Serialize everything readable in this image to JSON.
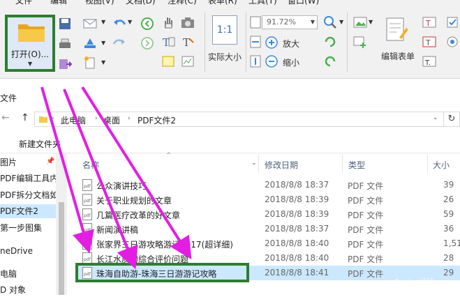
{
  "menubar": {
    "items": [
      "文件",
      "编辑",
      "视图(V)",
      "文档(D)",
      "注释(C)",
      "表单(R)",
      "工具(T)",
      "窗口(W)"
    ]
  },
  "ribbon": {
    "open_label": "打开(O)...",
    "zoom_value": "91.72%",
    "zoom_in_label": "放大",
    "zoom_out_label": "缩小",
    "actual_size_label": "实际大小",
    "actual_size_icon_text": "1:1",
    "edit_form_label": "编辑表单",
    "colors": {
      "highlight_border": "#2e7d32",
      "arrow": "#e31ee3"
    }
  },
  "explorer": {
    "title": "文件",
    "breadcrumb": [
      "此电脑",
      "桌面",
      "PDF文件2"
    ],
    "new_folder_label": "新建文件夹",
    "nav_items": [
      "图片",
      "PDF编辑工具内公",
      "PDF拆分文档如何",
      "PDF文件2",
      "第一步图集",
      "neDrive",
      "电脑",
      "D 对象"
    ],
    "selected_nav": "PDF文件2",
    "columns": {
      "name": "名称",
      "date": "修改日期",
      "type": "类型",
      "size": "大小"
    },
    "files": [
      {
        "name": "公众演讲技巧",
        "date": "2018/8/8 18:37",
        "type": "PDF 文件",
        "size": "39"
      },
      {
        "name": "关于职业规划的文章",
        "date": "2018/8/8 18:39",
        "type": "PDF 文件",
        "size": "26"
      },
      {
        "name": "几篇医疗改革的好文章",
        "date": "2018/8/8 18:39",
        "type": "PDF 文件",
        "size": "59"
      },
      {
        "name": "新闻演讲稿",
        "date": "2018/8/8 18:37",
        "type": "PDF 文件",
        "size": "36"
      },
      {
        "name": "张家界三日游攻略游记2017(超详细)",
        "date": "2018/8/8 18:40",
        "type": "PDF 文件",
        "size": "1,51"
      },
      {
        "name": "长江水质的综合评价问题",
        "date": "2018/8/8 18:40",
        "type": "PDF 文件",
        "size": "28"
      },
      {
        "name": "珠海自助游-珠海三日游游记攻略",
        "date": "2018/8/8 18:41",
        "type": "PDF 文件",
        "size": "29"
      }
    ],
    "selected_file": "珠海自助游-珠海三日游游记攻略"
  },
  "watermark": "Baidu 经验"
}
